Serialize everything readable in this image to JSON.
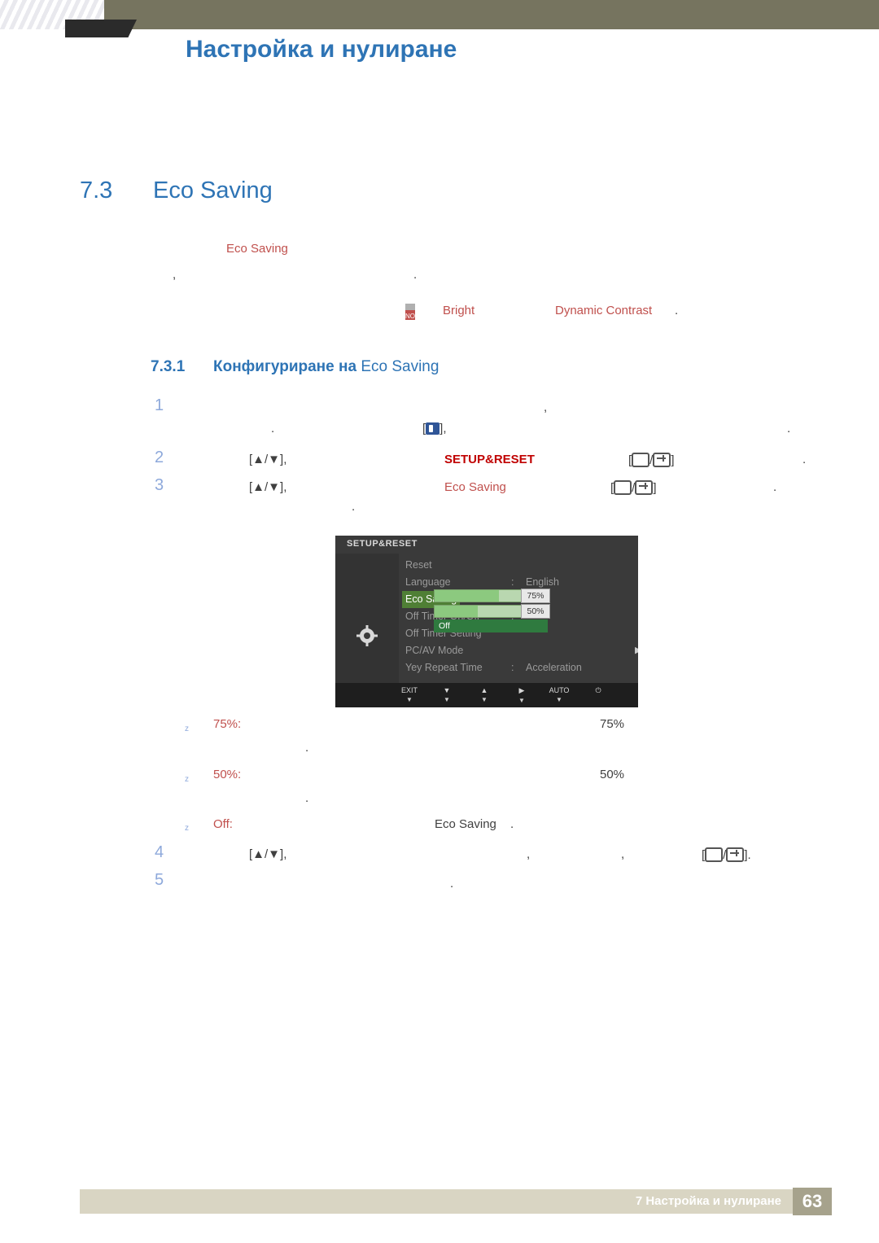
{
  "header": {
    "title": "Настройка и нулиране"
  },
  "section": {
    "number": "7.3",
    "title": "Eco Saving"
  },
  "intro": {
    "eco_label": "Eco Saving",
    "comma": ",",
    "dot1": ".",
    "note_icon": "note-icon",
    "bright": "Bright",
    "dynamic_contrast": "Dynamic Contrast",
    "dot2": "."
  },
  "subsection": {
    "number": "7.3.1",
    "title_bold": "Конфигуриране на ",
    "title_regular": "Eco Saving"
  },
  "steps": [
    {
      "num": "1",
      "line1_comma": ",",
      "line2_dot": ".",
      "bracket_open": "[",
      "bracket_close": "],",
      "tail_dot": "."
    },
    {
      "num": "2",
      "keys": "[▲/▼],",
      "target": "SETUP&RESET",
      "btn_open": "[",
      "btn_close": "]",
      "tail": "."
    },
    {
      "num": "3",
      "keys": "[▲/▼],",
      "target": "Eco Saving",
      "btn_open": "[",
      "btn_close": "]",
      "tail": ".",
      "sub_dot": "."
    },
    {
      "num": "4",
      "keys": "[▲/▼],",
      "comma1": ",",
      "comma2": ",",
      "btn_open": "[",
      "btn_close": "]."
    },
    {
      "num": "5",
      "dot": "."
    }
  ],
  "osd": {
    "title": "SETUP&RESET",
    "gear_icon": "gear-icon",
    "items": [
      {
        "label": "Reset",
        "colon": "",
        "value": ""
      },
      {
        "label": "Language",
        "colon": ":",
        "value": "English"
      },
      {
        "label": "Eco Saving",
        "colon": ":",
        "value": "",
        "selected": true
      },
      {
        "label": "Off Timer On/Off",
        "colon": ":",
        "value": ""
      },
      {
        "label": "Off Timer Setting",
        "colon": "",
        "value": ""
      },
      {
        "label": "PC/AV Mode",
        "colon": "",
        "value": "",
        "arrow": "▶"
      },
      {
        "label": "Yey Repeat Time",
        "colon": ":",
        "value": "Acceleration"
      }
    ],
    "scroll_glyph": "▼",
    "eco_options": [
      {
        "label": "75%",
        "fill_percent": 75
      },
      {
        "label": "50%",
        "fill_percent": 50
      },
      {
        "label": "Off"
      }
    ],
    "footer_buttons": [
      {
        "label": "EXIT",
        "glyph": "▼"
      },
      {
        "label": "▼",
        "glyph": "▼"
      },
      {
        "label": "▲",
        "glyph": "▼"
      },
      {
        "label": "▶",
        "glyph": "▼"
      },
      {
        "label": "AUTO",
        "glyph": "▼"
      },
      {
        "label": "⏻",
        "glyph": ""
      }
    ]
  },
  "bullets": [
    {
      "marker": "z",
      "label": "75%:",
      "value": "75%",
      "dot": "."
    },
    {
      "marker": "z",
      "label": "50%:",
      "value": "50%",
      "dot": "."
    },
    {
      "marker": "z",
      "label": "Off:",
      "value": "Eco Saving",
      "dot": "."
    }
  ],
  "footer": {
    "text": "7 Настройка и нулиране",
    "page": "63"
  },
  "colors": {
    "header_bar": "#76745f",
    "heading_blue": "#2e74b5",
    "accent_orange": "#c0504d",
    "accent_red": "#c00000",
    "step_number": "#8ea9db",
    "footer_band": "#d9d5c3",
    "page_box": "#a6a28c"
  }
}
